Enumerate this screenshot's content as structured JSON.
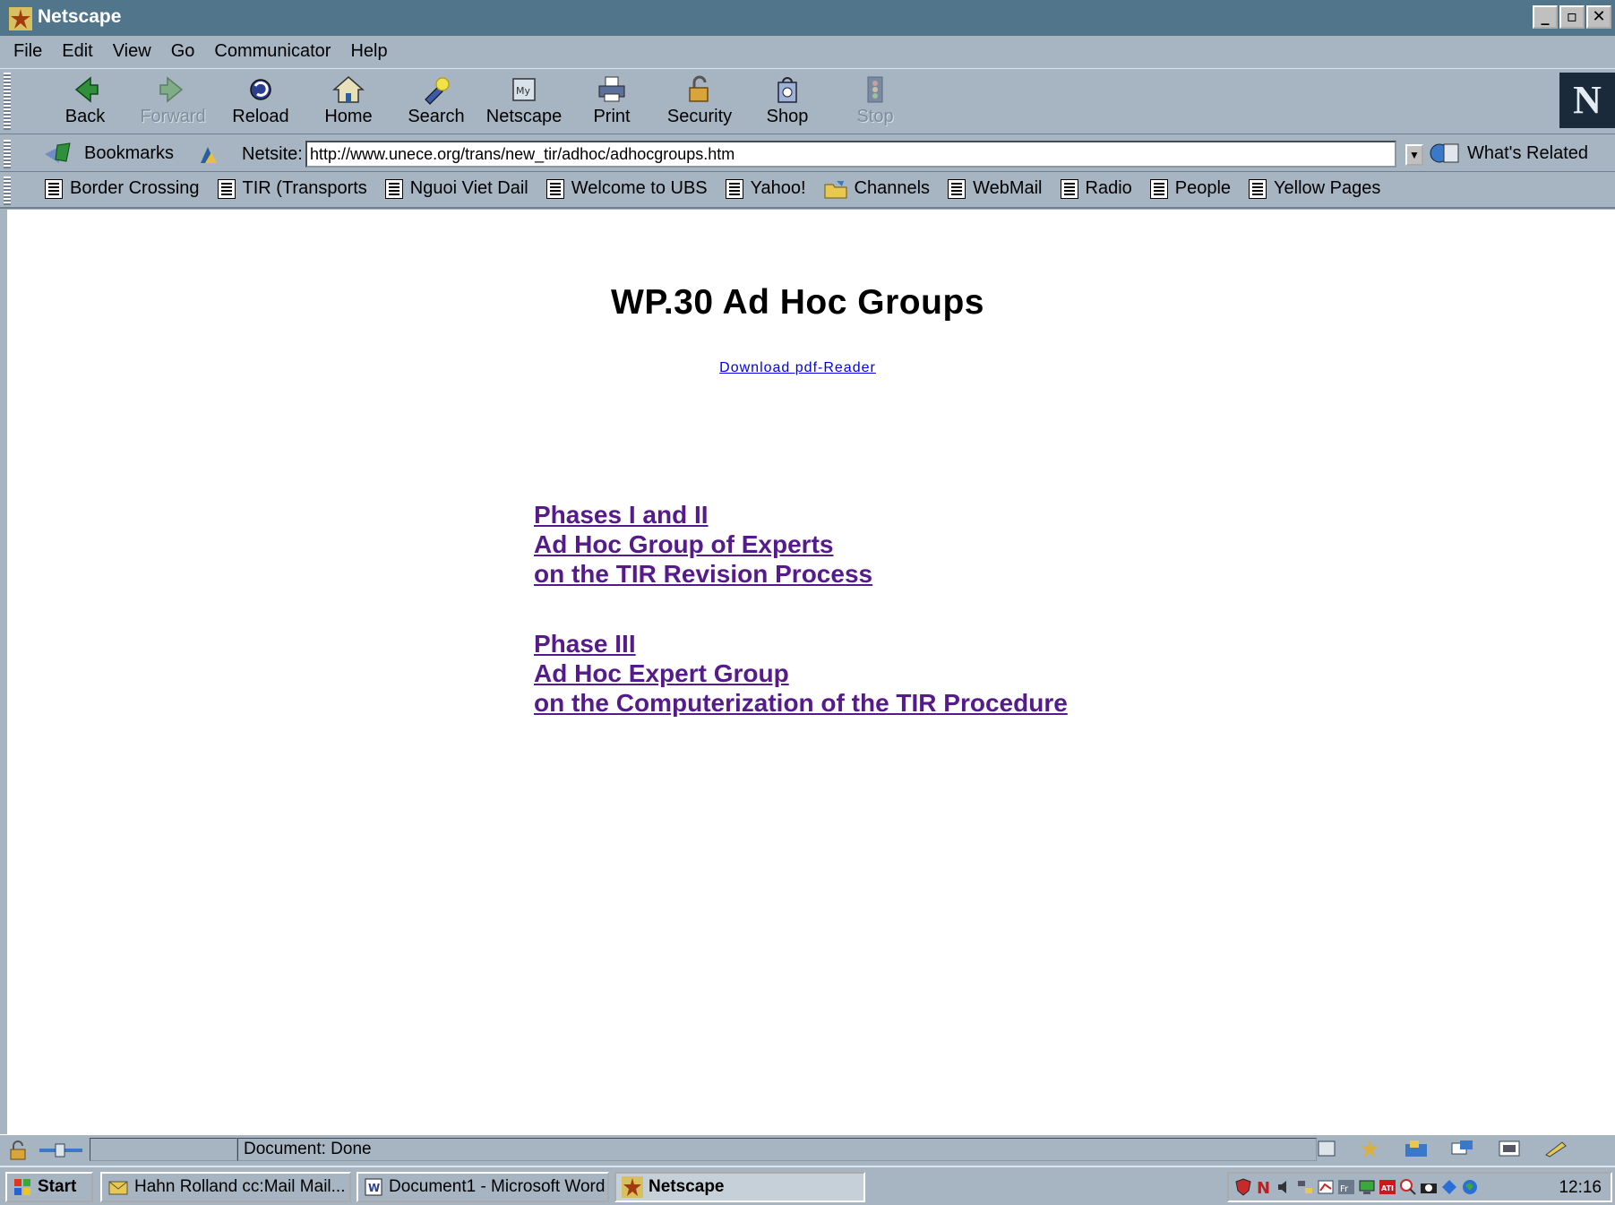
{
  "window": {
    "title": "Netscape"
  },
  "window_buttons": [
    "_",
    "▫",
    "✕"
  ],
  "menu": [
    "File",
    "Edit",
    "View",
    "Go",
    "Communicator",
    "Help"
  ],
  "nav_toolbar": {
    "back": "Back",
    "forward": "Forward",
    "reload": "Reload",
    "home": "Home",
    "search": "Search",
    "netscape": "Netscape",
    "print": "Print",
    "security": "Security",
    "shop": "Shop",
    "stop": "Stop"
  },
  "location_bar": {
    "bookmarks_label": "Bookmarks",
    "netsite_label": "Netsite:",
    "url": "http://www.unece.org/trans/new_tir/adhoc/adhocgroups.htm",
    "whats_related": "What's Related"
  },
  "personal_toolbar": [
    "Border Crossing",
    "TIR (Transports",
    "Nguoi Viet Dail",
    "Welcome to UBS",
    "Yahoo!",
    "Channels",
    "WebMail",
    "Radio",
    "People",
    "Yellow Pages"
  ],
  "page": {
    "title": "WP.30 Ad Hoc Groups",
    "pdf_link": "Download pdf-Reader",
    "link_group_1": [
      "Phases I and II",
      "Ad Hoc Group of Experts",
      "on the TIR Revision Process"
    ],
    "link_group_2": [
      "Phase III",
      "Ad Hoc Expert Group",
      "on the Computerization of the TIR Procedure"
    ]
  },
  "status": {
    "text": "Document: Done"
  },
  "taskbar": {
    "start": "Start",
    "items": [
      "Hahn Rolland cc:Mail Mail...",
      "Document1 - Microsoft Word",
      "Netscape"
    ],
    "clock": "12:16"
  },
  "colors": {
    "chrome": "#a7b5c2",
    "titlebar": "#51758a",
    "visited_link": "#551a8b",
    "link": "#0000ee"
  }
}
